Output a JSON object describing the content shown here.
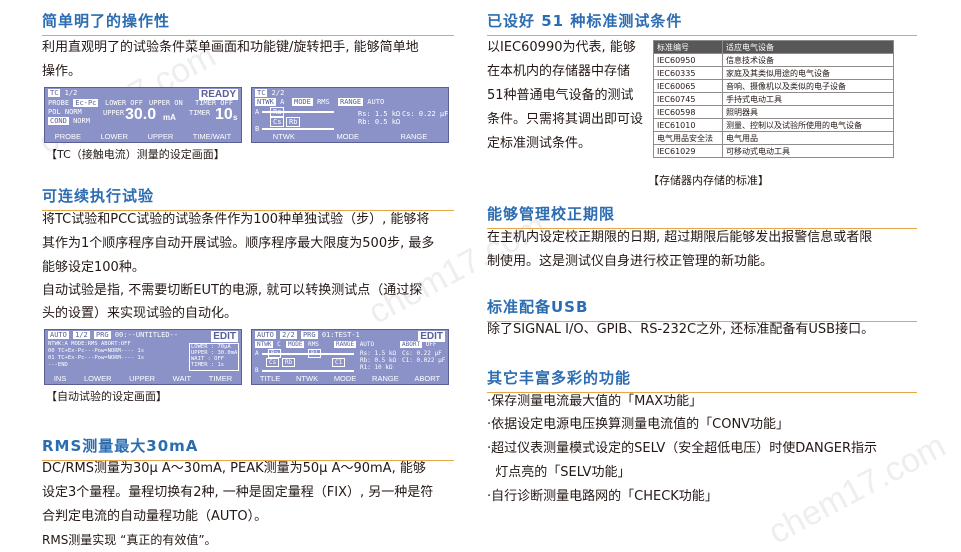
{
  "left": {
    "s1": {
      "title": "简单明了的操作性",
      "lines": [
        "利用直观明了的试验条件菜单画面和功能键/旋转把手, 能够简单地",
        "操作。"
      ],
      "caption": "【TC（接触电流）测量的设定画面】",
      "lcd1": {
        "tc": "TC",
        "page": "1/2",
        "status": "READY",
        "probe": "PROBE",
        "probe_val": "Ec-Pc",
        "lower_lbl": "LOWER",
        "lower_val": "OFF",
        "upper_lbl": "UPPER",
        "upper_val": "ON",
        "timer_lbl": "TIMER",
        "timer_val": "OFF",
        "pol": "POL",
        "pol_val": "NORM",
        "cond": "COND",
        "cond_val": "NORM",
        "upper_small": "UPPER",
        "reading": "30.0",
        "reading_unit": "mA",
        "timer_small": "TIMER",
        "timer_reading": "10",
        "timer_unit": "s",
        "menu": [
          "PROBE",
          "LOWER",
          "UPPER",
          "TIME/WAIT"
        ]
      },
      "lcd2": {
        "tc": "TC",
        "page": "2/2",
        "ntwk": "NTWK",
        "ntwk_val": "A",
        "mode": "MODE",
        "mode_val": "RMS",
        "range": "RANGE",
        "range_val": "AUTO",
        "a": "A",
        "b": "B",
        "ra": "Ra",
        "cs": "Cs",
        "rb": "Rb",
        "rs": "Rs: 1.5 kΩ",
        "csv": "Cs: 0.22 μF",
        "rbv": "Rb: 0.5 kΩ",
        "menu": [
          "NTWK",
          "MODE",
          "RANGE"
        ]
      }
    },
    "s2": {
      "title": "可连续执行试验",
      "lines": [
        "将TC试验和PCC试验的试验条件作为100种单独试验（步）, 能够将",
        "其作为1个顺序程序自动开展试验。顺序程序最大限度为500步, 最多",
        "能够设定100种。",
        "自动试验是指, 不需要切断EUT的电源, 就可以转换测试点（通过探",
        "头的设置）来实现试验的自动化。"
      ],
      "caption": "【自动试验的设定画面】",
      "lcd3": {
        "auto": "AUTO",
        "page": "1/2",
        "prg": "PRG",
        "prg_name": "00:--UNTITLED--",
        "status": "EDIT",
        "l1": "NTWK:A  MODE:RMS  ABORT:OFF",
        "l2": "00 TC+Ex-Pc---Pow=NORM---- 1s",
        "l3": "01 TC+Ex-Pc---Pow=NORM---- 1s",
        "l4": "---END",
        "r1": "LOWER  :  70μA",
        "r2": "UPPER : 30.0mA",
        "r3": "WAIT   :  OFF",
        "r4": "TIMER  :   1s",
        "menu": [
          "INS",
          "LOWER",
          "UPPER",
          "WAIT",
          "TIMER"
        ]
      },
      "lcd4": {
        "auto": "AUTO",
        "page": "2/2",
        "prg": "PRG",
        "prg_name": "01:TEST-1",
        "status": "EDIT",
        "ntwk": "NTWK",
        "ntwk_val": "C",
        "mode": "MODE",
        "mode_val": "RMS",
        "range": "RANGE",
        "range_val": "AUTO",
        "abort": "ABORT",
        "abort_val": "OFF",
        "a": "A",
        "b": "B",
        "ra": "Ra",
        "cs": "Cs",
        "rb": "Rb",
        "r1": "R1",
        "c1": "C1",
        "rs": "Rs: 1.5 kΩ",
        "csv": "Cs: 0.22 μF",
        "rbv": "Rb: 0.5 kΩ",
        "c1v": "C1: 0.022 μF",
        "r1v": "R1: 10 kΩ",
        "menu": [
          "TITLE",
          "NTWK",
          "MODE",
          "RANGE",
          "ABORT"
        ]
      }
    },
    "s3": {
      "title": "RMS测量最大30mA",
      "lines": [
        "DC/RMS测量为30μ A～30mA, PEAK测量为50μ A～90mA, 能够",
        "设定3个量程。量程切换有2种, 一种是固定量程（FIX）, 另一种是符",
        "合判定电流的自动量程功能（AUTO）。",
        "RMS测量实现 “真正的有效值”。"
      ]
    }
  },
  "right": {
    "s4": {
      "title": "已设好 51 种标准测试条件",
      "lines": [
        "以IEC60990为代表, 能够",
        "在本机内的存储器中存储",
        "51种普通电气设备的测试",
        "条件。只需将其调出即可设",
        "定标准测试条件。"
      ],
      "table": {
        "headers": [
          "标准编号",
          "适应电气设备"
        ],
        "rows": [
          [
            "IEC60950",
            "信息技术设备"
          ],
          [
            "IEC60335",
            "家庭及其类似用途的电气设备"
          ],
          [
            "IEC60065",
            "音响、摄像机以及类似的电子设备"
          ],
          [
            "IEC60745",
            "手持式电动工具"
          ],
          [
            "IEC60598",
            "照明器具"
          ],
          [
            "IEC61010",
            "测量、控制以及试验所使用的电气设备"
          ],
          [
            "电气用品安全法",
            "电气用品"
          ],
          [
            "IEC61029",
            "可移动式电动工具"
          ]
        ]
      },
      "caption": "【存储器内存储的标准】"
    },
    "s5": {
      "title": "能够管理校正期限",
      "lines": [
        "在主机内设定校正期限的日期, 超过期限后能够发出报警信息或者限",
        "制使用。这是测试仪自身进行校正管理的新功能。"
      ]
    },
    "s6": {
      "title": "标准配备USB",
      "lines": [
        "除了SIGNAL I/O、GPIB、RS-232C之外, 还标准配备有USB接口。"
      ]
    },
    "s7": {
      "title": "其它丰富多彩的功能",
      "bullets": [
        "·保存测量电流最大值的「MAX功能」",
        "·依据设定电源电压换算测量电流值的「CONV功能」",
        "·超过仪表测量模式设定的SELV（安全超低电压）时使DANGER指示",
        "  灯点亮的「SELV功能」",
        "·自行诊断测量电路网的「CHECK功能」"
      ]
    }
  },
  "watermark": "chem17.com"
}
